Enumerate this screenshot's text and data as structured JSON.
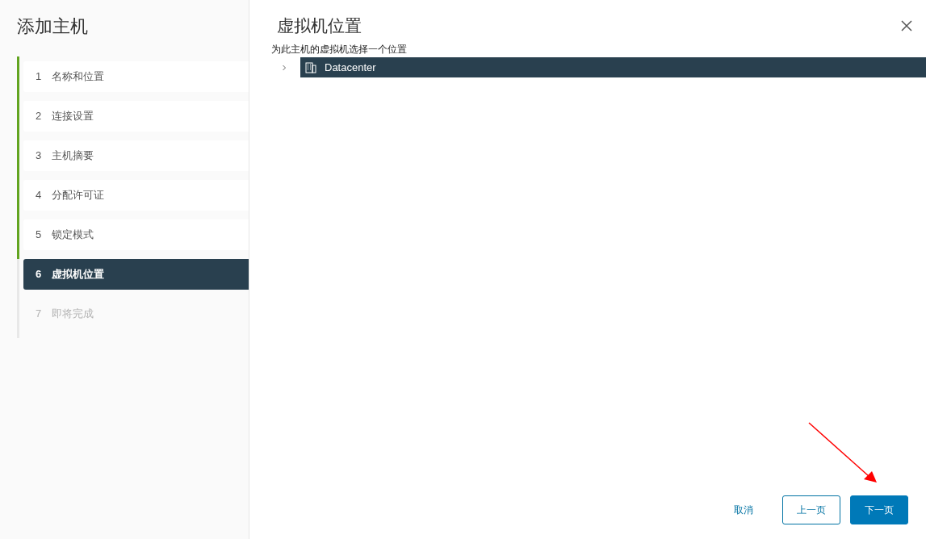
{
  "sidebar": {
    "title": "添加主机",
    "steps": [
      {
        "number": "1",
        "label": "名称和位置",
        "completed": true,
        "disabled": false,
        "selected": false
      },
      {
        "number": "2",
        "label": "连接设置",
        "completed": true,
        "disabled": false,
        "selected": false
      },
      {
        "number": "3",
        "label": "主机摘要",
        "completed": true,
        "disabled": false,
        "selected": false
      },
      {
        "number": "4",
        "label": "分配许可证",
        "completed": true,
        "disabled": false,
        "selected": false
      },
      {
        "number": "5",
        "label": "锁定模式",
        "completed": true,
        "disabled": false,
        "selected": false
      },
      {
        "number": "6",
        "label": "虚拟机位置",
        "completed": false,
        "disabled": false,
        "selected": true
      },
      {
        "number": "7",
        "label": "即将完成",
        "completed": false,
        "disabled": true,
        "selected": false
      }
    ]
  },
  "content": {
    "title": "虚拟机位置",
    "subtitle": "为此主机的虚拟机选择一个位置",
    "tree": [
      {
        "label": "Datacenter",
        "expanded": false,
        "selected": true
      }
    ]
  },
  "buttons": [
    {
      "label": "取消",
      "kind": "flat"
    },
    {
      "label": "上一页",
      "kind": "outline"
    },
    {
      "label": "下一页",
      "kind": "primary"
    }
  ]
}
